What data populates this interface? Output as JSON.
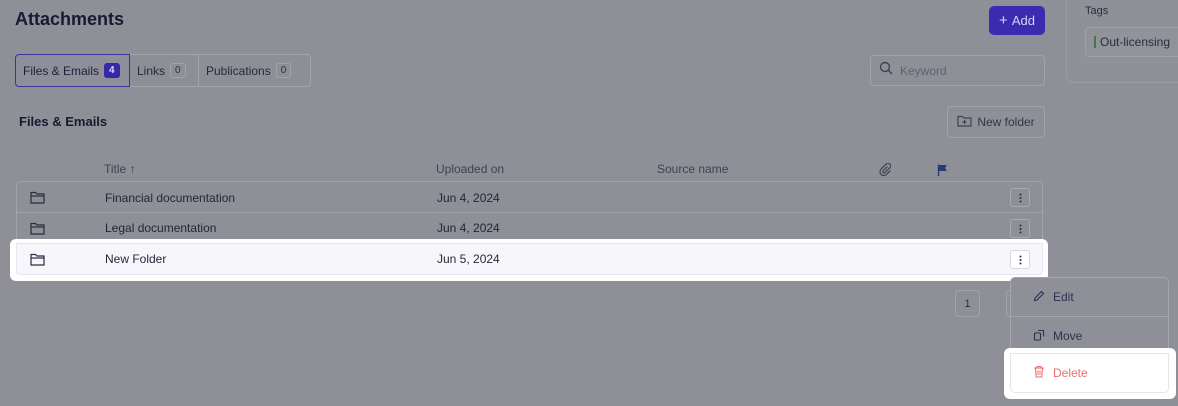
{
  "header": {
    "title": "Attachments",
    "add_label": "Add"
  },
  "tags": {
    "label": "Tags",
    "chip": "Out-licensing"
  },
  "tabs": [
    {
      "label": "Files & Emails",
      "count": "4"
    },
    {
      "label": "Links",
      "count": "0"
    },
    {
      "label": "Publications",
      "count": "0"
    }
  ],
  "search": {
    "placeholder": "Keyword"
  },
  "section": {
    "title": "Files & Emails",
    "new_folder_label": "New folder"
  },
  "table": {
    "headers": {
      "title": "Title",
      "sort_indicator": "↑",
      "uploaded": "Uploaded on",
      "source": "Source name"
    },
    "rows": [
      {
        "title": "Financial documentation",
        "uploaded": "Jun 4, 2024"
      },
      {
        "title": "Legal documentation",
        "uploaded": "Jun 4, 2024"
      },
      {
        "title": "New Folder",
        "uploaded": "Jun 5, 2024"
      }
    ]
  },
  "pagination": {
    "page": "1"
  },
  "menu": {
    "edit": "Edit",
    "move": "Move",
    "delete": "Delete"
  },
  "colors": {
    "accent": "#3a2bb0",
    "danger": "#e96f6f",
    "overlay": "#8f8f97"
  }
}
